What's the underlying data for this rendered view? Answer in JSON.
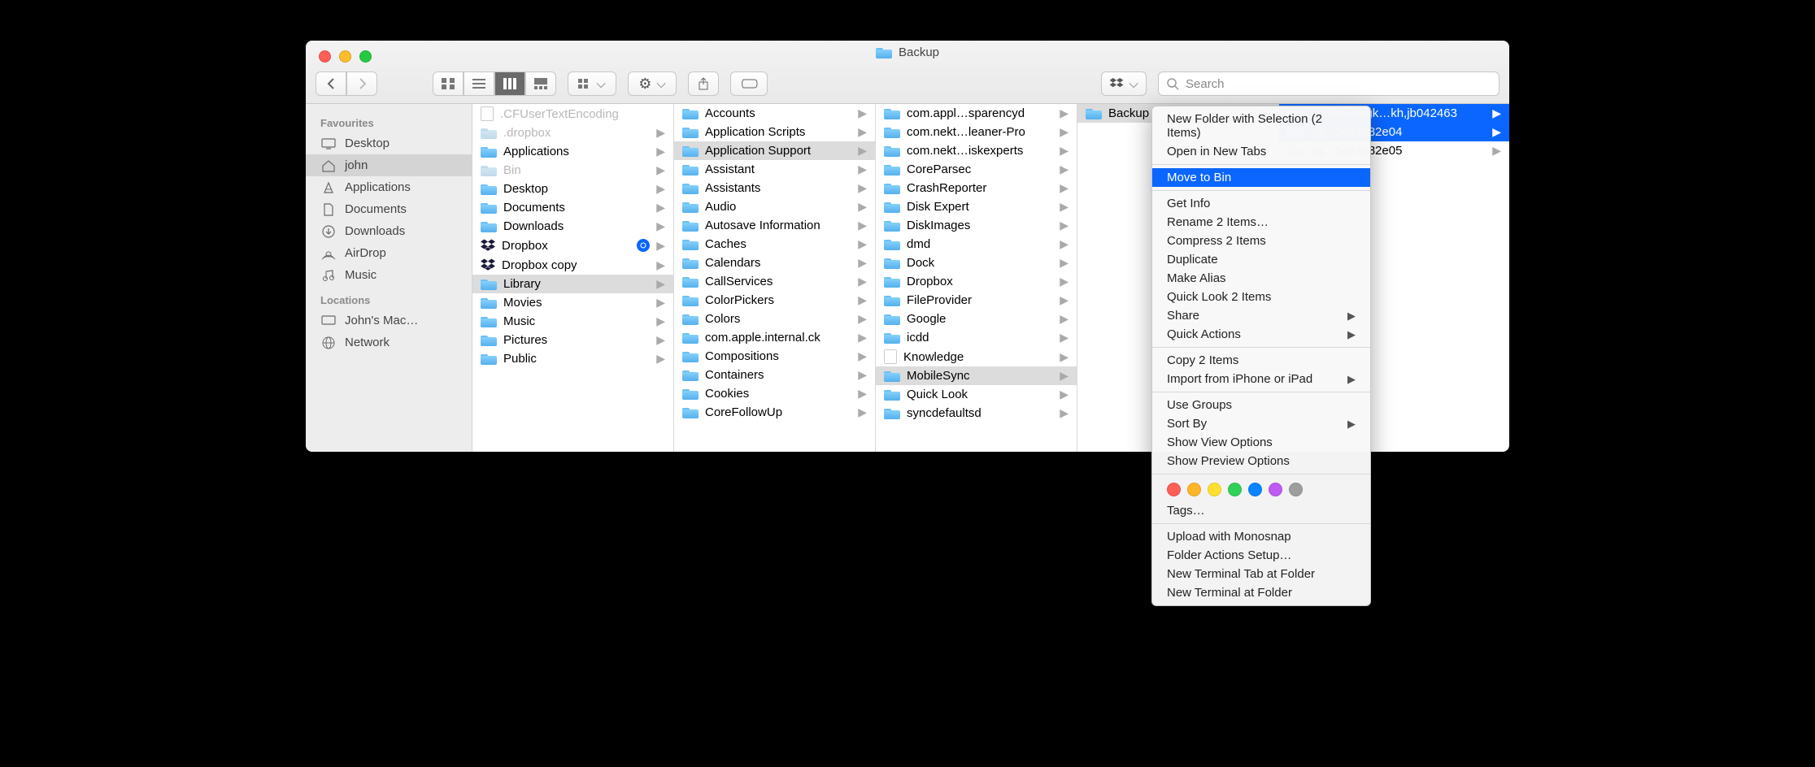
{
  "window": {
    "title": "Backup"
  },
  "toolbar": {
    "search_placeholder": "Search"
  },
  "sidebar": {
    "favourites_label": "Favourites",
    "locations_label": "Locations",
    "favourites": [
      {
        "icon": "desktop",
        "label": "Desktop"
      },
      {
        "icon": "home",
        "label": "john",
        "selected": true
      },
      {
        "icon": "apps",
        "label": "Applications"
      },
      {
        "icon": "doc",
        "label": "Documents"
      },
      {
        "icon": "download",
        "label": "Downloads"
      },
      {
        "icon": "airdrop",
        "label": "AirDrop"
      },
      {
        "icon": "music",
        "label": "Music"
      }
    ],
    "locations": [
      {
        "icon": "disk",
        "label": "John's Mac…"
      },
      {
        "icon": "network",
        "label": "Network"
      }
    ]
  },
  "columns": [
    {
      "items": [
        {
          "type": "file",
          "name": ".CFUserTextEncoding",
          "dim": true
        },
        {
          "type": "folder",
          "name": ".dropbox",
          "dim": true,
          "chev": true
        },
        {
          "type": "folder",
          "name": "Applications",
          "chev": true
        },
        {
          "type": "folder",
          "name": "Bin",
          "dim": true,
          "chev": true
        },
        {
          "type": "folder",
          "name": "Desktop",
          "chev": true
        },
        {
          "type": "folder",
          "name": "Documents",
          "chev": true
        },
        {
          "type": "folder",
          "name": "Downloads",
          "chev": true
        },
        {
          "type": "dropbox",
          "name": "Dropbox",
          "chev": true,
          "badge": true
        },
        {
          "type": "dropbox",
          "name": "Dropbox copy",
          "chev": true
        },
        {
          "type": "folder",
          "name": "Library",
          "open": true,
          "dim": true,
          "chev": true
        },
        {
          "type": "folder",
          "name": "Movies",
          "chev": true
        },
        {
          "type": "folder",
          "name": "Music",
          "chev": true
        },
        {
          "type": "folder",
          "name": "Pictures",
          "chev": true
        },
        {
          "type": "folder",
          "name": "Public",
          "chev": true
        }
      ]
    },
    {
      "items": [
        {
          "type": "folder",
          "name": "Accounts",
          "chev": true
        },
        {
          "type": "folder",
          "name": "Application Scripts",
          "chev": true
        },
        {
          "type": "folder",
          "name": "Application Support",
          "open": true,
          "chev": true
        },
        {
          "type": "folder",
          "name": "Assistant",
          "chev": true
        },
        {
          "type": "folder",
          "name": "Assistants",
          "chev": true
        },
        {
          "type": "folder",
          "name": "Audio",
          "chev": true
        },
        {
          "type": "folder",
          "name": "Autosave Information",
          "chev": true
        },
        {
          "type": "folder",
          "name": "Caches",
          "chev": true
        },
        {
          "type": "folder",
          "name": "Calendars",
          "chev": true
        },
        {
          "type": "folder",
          "name": "CallServices",
          "chev": true
        },
        {
          "type": "folder",
          "name": "ColorPickers",
          "chev": true
        },
        {
          "type": "folder",
          "name": "Colors",
          "chev": true
        },
        {
          "type": "folder",
          "name": "com.apple.internal.ck",
          "chev": true
        },
        {
          "type": "folder",
          "name": "Compositions",
          "chev": true
        },
        {
          "type": "folder",
          "name": "Containers",
          "chev": true
        },
        {
          "type": "folder",
          "name": "Cookies",
          "chev": true
        },
        {
          "type": "folder",
          "name": "CoreFollowUp",
          "chev": true
        }
      ]
    },
    {
      "items": [
        {
          "type": "folder",
          "name": "com.appl…sparencyd",
          "chev": true
        },
        {
          "type": "folder",
          "name": "com.nekt…leaner-Pro",
          "chev": true
        },
        {
          "type": "folder",
          "name": "com.nekt…iskexperts",
          "chev": true
        },
        {
          "type": "folder",
          "name": "CoreParsec",
          "chev": true
        },
        {
          "type": "folder",
          "name": "CrashReporter",
          "chev": true
        },
        {
          "type": "folder",
          "name": "Disk Expert",
          "chev": true
        },
        {
          "type": "folder",
          "name": "DiskImages",
          "chev": true
        },
        {
          "type": "folder",
          "name": "dmd",
          "chev": true
        },
        {
          "type": "folder",
          "name": "Dock",
          "chev": true
        },
        {
          "type": "folder",
          "name": "Dropbox",
          "chev": true
        },
        {
          "type": "folder",
          "name": "FileProvider",
          "chev": true
        },
        {
          "type": "folder",
          "name": "Google",
          "chev": true
        },
        {
          "type": "folder",
          "name": "icdd",
          "chev": true
        },
        {
          "type": "file",
          "name": "Knowledge",
          "chev": true
        },
        {
          "type": "folder",
          "name": "MobileSync",
          "open": true,
          "chev": true
        },
        {
          "type": "folder",
          "name": "Quick Look",
          "chev": true
        },
        {
          "type": "folder",
          "name": "syncdefaultsd",
          "chev": true
        }
      ]
    },
    {
      "items": [
        {
          "type": "folder",
          "name": "Backup",
          "open": true,
          "chev": true
        }
      ]
    },
    {
      "items": [
        {
          "type": "folder",
          "name": "ef9fOc5asgk…kh,jb042463",
          "selected": true,
          "chev": true
        },
        {
          "type": "folder",
          "name": "sg…0424c82e04",
          "selected": true,
          "chev": true
        },
        {
          "type": "folder",
          "name": "sg…0424c82e05",
          "chev": true
        }
      ]
    }
  ],
  "context_menu": {
    "groups": [
      [
        {
          "label": "New Folder with Selection (2 Items)"
        },
        {
          "label": "Open in New Tabs"
        }
      ],
      [
        {
          "label": "Move to Bin",
          "selected": true
        }
      ],
      [
        {
          "label": "Get Info"
        },
        {
          "label": "Rename 2 Items…"
        },
        {
          "label": "Compress 2 Items"
        },
        {
          "label": "Duplicate"
        },
        {
          "label": "Make Alias"
        },
        {
          "label": "Quick Look 2 Items"
        },
        {
          "label": "Share",
          "submenu": true
        },
        {
          "label": "Quick Actions",
          "submenu": true
        }
      ],
      [
        {
          "label": "Copy 2 Items"
        },
        {
          "label": "Import from iPhone or iPad",
          "submenu": true
        }
      ],
      [
        {
          "label": "Use Groups"
        },
        {
          "label": "Sort By",
          "submenu": true
        },
        {
          "label": "Show View Options"
        },
        {
          "label": "Show Preview Options"
        }
      ],
      "tags",
      [
        {
          "label": "Upload with Monosnap"
        },
        {
          "label": "Folder Actions Setup…"
        },
        {
          "label": "New Terminal Tab at Folder"
        },
        {
          "label": "New Terminal at Folder"
        }
      ]
    ],
    "tags_label": "Tags…",
    "tag_colors": [
      "#ff5f57",
      "#ffb528",
      "#ffe030",
      "#30d158",
      "#0a84ff",
      "#bf5af2",
      "#9e9e9e"
    ]
  }
}
